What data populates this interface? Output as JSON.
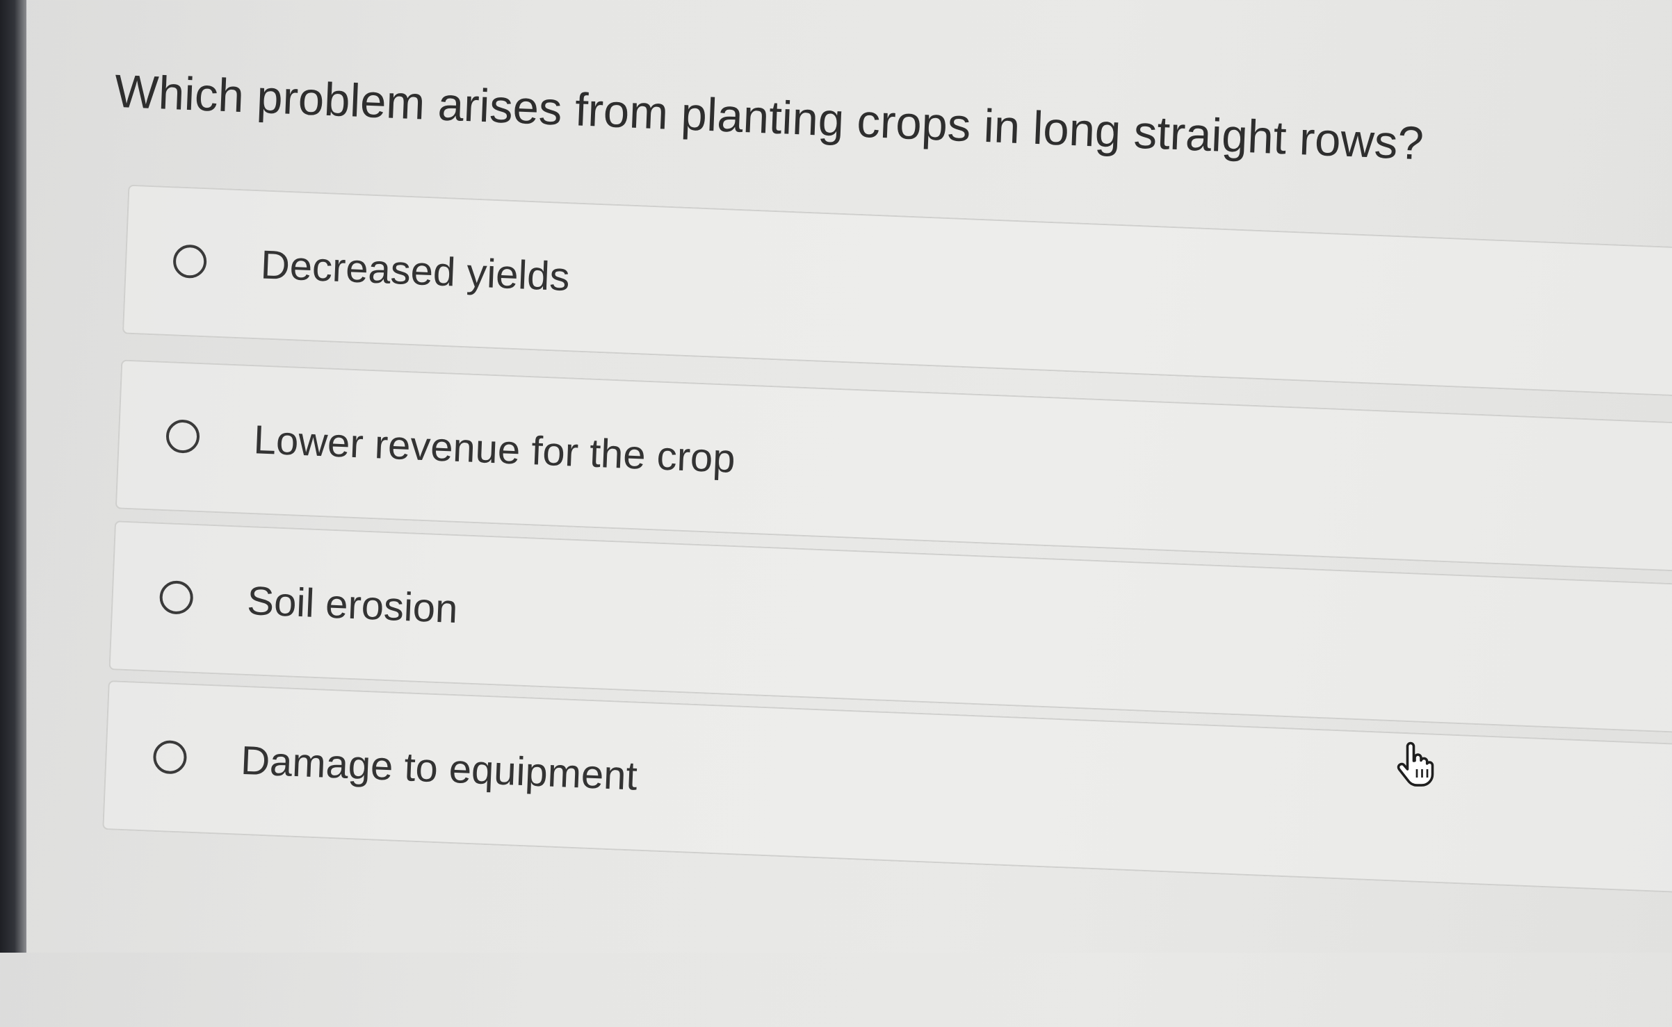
{
  "question": {
    "text": "Which problem arises from planting crops in long straight rows?"
  },
  "options": [
    {
      "label": "Decreased yields",
      "selected": false
    },
    {
      "label": "Lower revenue for the crop",
      "selected": false
    },
    {
      "label": "Soil erosion",
      "selected": false
    },
    {
      "label": "Damage to equipment",
      "selected": false
    }
  ],
  "cursor": {
    "icon": "hand-pointer-icon"
  },
  "colors": {
    "background": "#e6e6e4",
    "text": "#2e2e2e",
    "border": "#cfcfcd"
  }
}
